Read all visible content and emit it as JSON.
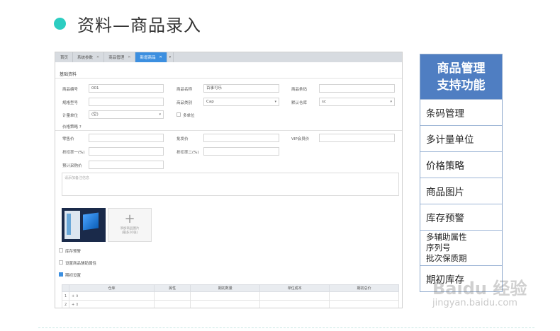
{
  "slide": {
    "title": "资料—商品录入"
  },
  "app": {
    "tabs": [
      {
        "label": "首页"
      },
      {
        "label": "系统参数"
      },
      {
        "label": "商品管理"
      },
      {
        "label": "新增商品"
      }
    ],
    "section_title": "基础资料",
    "fields": {
      "code_label": "商品编号",
      "code_value": "001",
      "name_label": "商品名称",
      "name_value": "百事可乐",
      "barcode_label": "商品条码",
      "model_label": "规格型号",
      "category_label": "商品类别",
      "category_value": "Cap",
      "warehouse_label": "默认仓库",
      "warehouse_value": "sc",
      "unit_label": "计量单位",
      "unit_value": "(空)",
      "multi_unit_label": "多单位",
      "price_strategy_label": "价格策略 ?",
      "retail_label": "零售价",
      "wholesale_label": "批发价",
      "vip_label": "VIP会员价",
      "discount1_label": "折扣率一(%)",
      "discount2_label": "折扣率二(%)",
      "purchase_label": "预计采购价",
      "remark_placeholder": "请添加备注信息"
    },
    "add_image": {
      "text1": "添加商品图片",
      "text2": "(最多20张)"
    },
    "options": {
      "stock_alert": "库存预警",
      "aux_attr": "设置商品辅助属性",
      "initial": "期初设置"
    },
    "grid": {
      "headers": [
        "",
        "仓库",
        "属性",
        "期初数量",
        "单位成本",
        "期初总价"
      ],
      "rows": [
        {
          "num": "1",
          "add": "+ ⇕"
        },
        {
          "num": "2",
          "add": "+ ⇕"
        }
      ]
    }
  },
  "panel": {
    "head_line1": "商品管理",
    "head_line2": "支持功能",
    "features": [
      "条码管理",
      "多计量单位",
      "价格策略",
      "商品图片",
      "库存预警"
    ],
    "multi": [
      "多辅助属性",
      "序列号",
      "批次保质期"
    ],
    "last": "期初库存"
  },
  "watermark": {
    "brand": "Baidu 经验",
    "url": "jingyan.baidu.com"
  }
}
